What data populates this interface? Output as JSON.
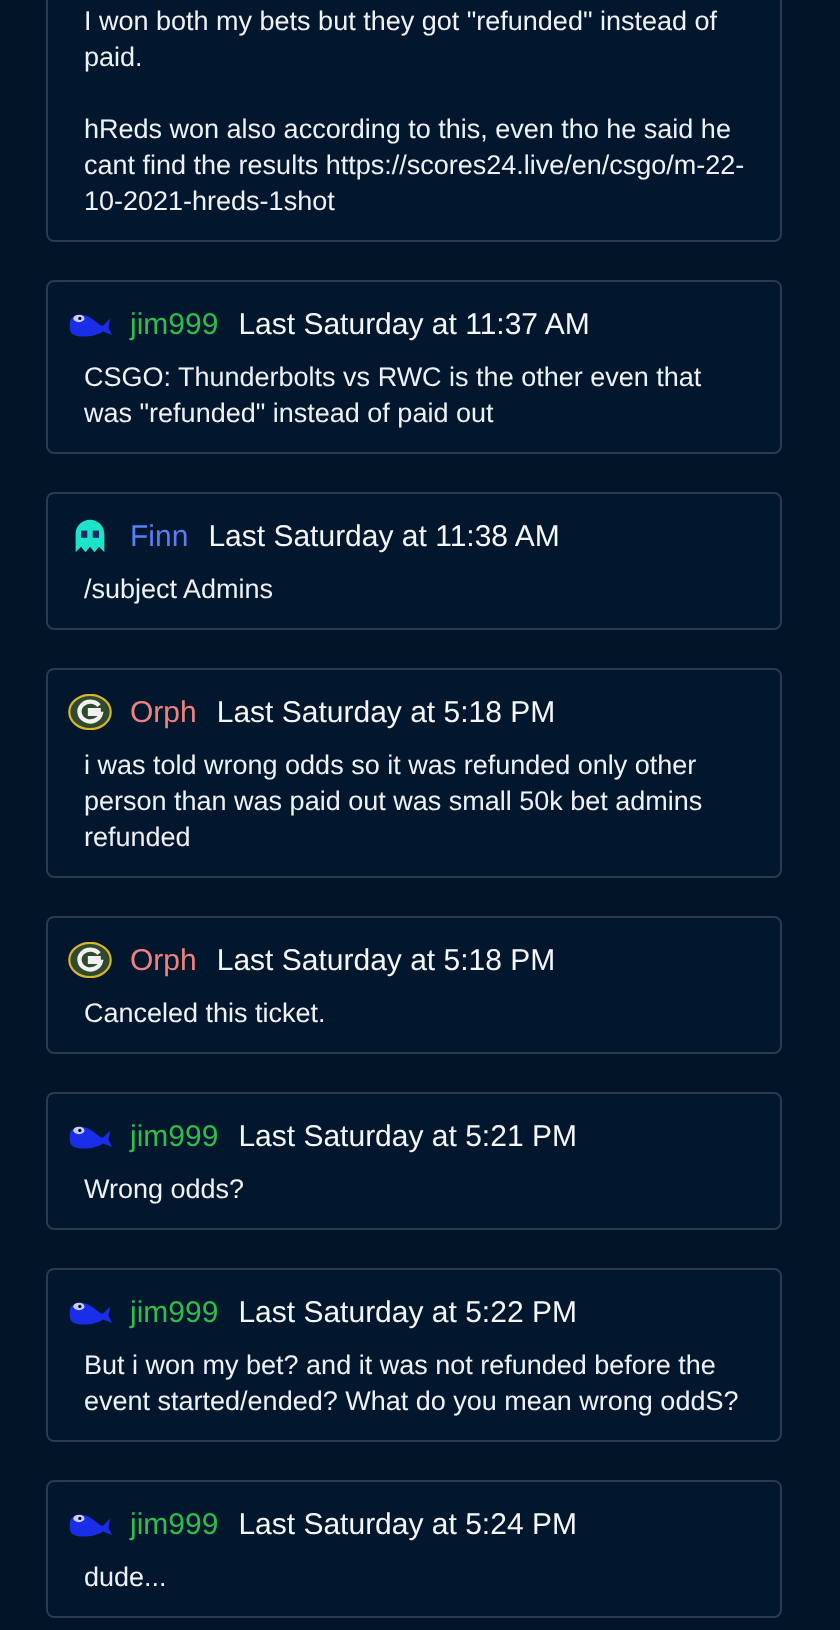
{
  "messages": [
    {
      "cut_top": true,
      "text": "I won both my bets but they got \"refunded\" instead of paid.\n\nhReds won also according to this, even tho he said he cant find the results https://scores24.live/en/csgo/m-22-10-2021-hreds-1shot"
    },
    {
      "kind": "whale",
      "author": "jim999",
      "color": "#2ebd4e",
      "time": "Last Saturday at 11:37 AM",
      "text": "CSGO: Thunderbolts vs RWC is the other even that was \"refunded\" instead of paid out"
    },
    {
      "kind": "ghost",
      "author": "Finn",
      "color": "#5b7ef2",
      "time": "Last Saturday at 11:38 AM",
      "text": "/subject Admins"
    },
    {
      "kind": "g-logo",
      "author": "Orph",
      "color": "#f0827e",
      "time": "Last Saturday at 5:18 PM",
      "text": "i was told wrong odds so it was refunded only other person than was paid out was small 50k bet admins refunded"
    },
    {
      "kind": "g-logo",
      "author": "Orph",
      "color": "#f0827e",
      "time": "Last Saturday at 5:18 PM",
      "text": "Canceled this ticket."
    },
    {
      "kind": "whale",
      "author": "jim999",
      "color": "#2ebd4e",
      "time": "Last Saturday at 5:21 PM",
      "text": "Wrong odds?"
    },
    {
      "kind": "whale",
      "author": "jim999",
      "color": "#2ebd4e",
      "time": "Last Saturday at 5:22 PM",
      "text": "But i won my bet? and it was not refunded before the event started/ended? What do you mean wrong oddS?"
    },
    {
      "kind": "whale",
      "author": "jim999",
      "color": "#2ebd4e",
      "time": "Last Saturday at 5:24 PM",
      "text": "dude..."
    }
  ]
}
